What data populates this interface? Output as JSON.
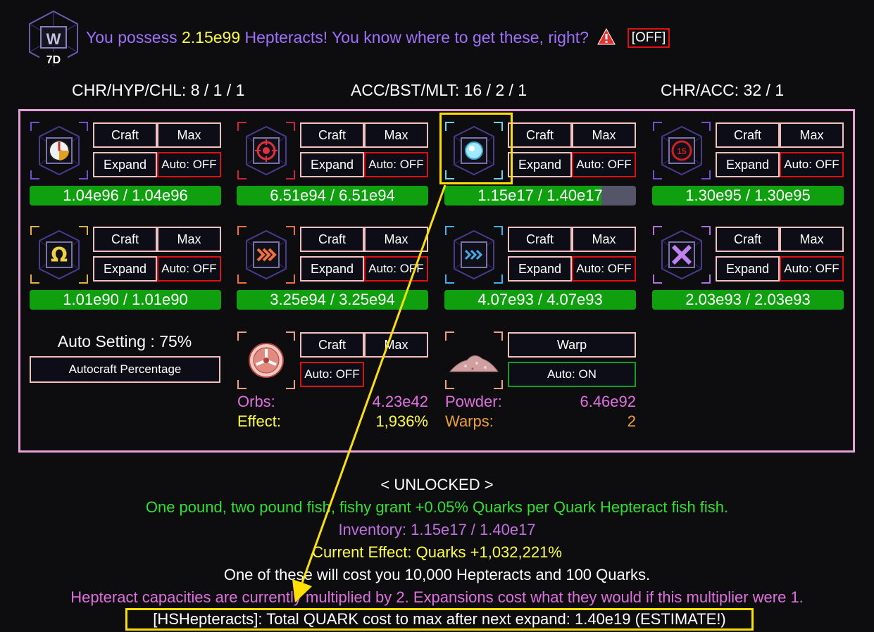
{
  "header": {
    "logo_text": "W",
    "logo_subtext": "7D",
    "prefix": "You possess",
    "amount": "2.15e99",
    "suffix": "Hepteracts! You know where to get these, right?",
    "toggle_label": "[OFF]"
  },
  "ratios": {
    "left": "CHR/HYP/CHL: 8 / 1 / 1",
    "middle": "ACC/BST/MLT: 16 / 2 / 1",
    "right": "CHR/ACC: 32 / 1"
  },
  "buttons": {
    "craft": "Craft",
    "max": "Max",
    "expand": "Expand",
    "auto_off": "Auto: OFF",
    "auto_on": "Auto: ON",
    "warp": "Warp"
  },
  "hepteracts": [
    {
      "name": "chronos",
      "icon": "clock-icon",
      "accent": "#7050d0",
      "bar_text": "1.04e96 / 1.04e96",
      "fill": 1.0
    },
    {
      "name": "hyperrealism",
      "icon": "target-icon",
      "accent": "#d02040",
      "bar_text": "6.51e94 / 6.51e94",
      "fill": 1.0
    },
    {
      "name": "quark",
      "icon": "quark-orb-icon",
      "accent": "#70d0f0",
      "bar_text": "1.15e17 / 1.40e17",
      "fill": 0.82
    },
    {
      "name": "challenge",
      "icon": "challenge-15-icon",
      "accent": "#7050d0",
      "bar_text": "1.30e95 / 1.30e95",
      "fill": 1.0
    },
    {
      "name": "abyss",
      "icon": "omega-icon",
      "accent": "#e0b040",
      "bar_text": "1.01e90 / 1.01e90",
      "fill": 1.0
    },
    {
      "name": "accelerator",
      "icon": "orange-chevrons-icon",
      "accent": "#f07040",
      "bar_text": "3.25e94 / 3.25e94",
      "fill": 1.0
    },
    {
      "name": "accelerator-boost",
      "icon": "blue-chevrons-icon",
      "accent": "#40b0f0",
      "bar_text": "4.07e93 / 4.07e93",
      "fill": 1.0
    },
    {
      "name": "multiplier",
      "icon": "x-icon",
      "accent": "#b070e0",
      "bar_text": "2.03e93 / 2.03e93",
      "fill": 1.0
    }
  ],
  "auto_setting": {
    "label": "Auto Setting : 75%",
    "button": "Autocraft Percentage"
  },
  "orbs": {
    "icon": "orb-icon",
    "orbs_label": "Orbs:",
    "orbs_value": "4.23e42",
    "effect_label": "Effect:",
    "effect_value": "1,936%"
  },
  "powder": {
    "icon": "powder-pile-icon",
    "powder_label": "Powder:",
    "powder_value": "6.46e92",
    "warps_label": "Warps:",
    "warps_value": "2"
  },
  "details": {
    "unlocked": "< UNLOCKED >",
    "description": "One pound, two pound fish, fishy grant +0.05% Quarks per Quark Hepteract fish fish.",
    "inventory": "Inventory: 1.15e17 / 1.40e17",
    "effect": "Current Effect: Quarks +1,032,221%",
    "cost": "One of these will cost you 10,000 Hepteracts and 100 Quarks.",
    "multiplier": "Hepteract capacities are currently multiplied by 2. Expansions cost what they would if this multiplier were 1.",
    "hs_estimate": "[HSHepteracts]: Total QUARK cost to max after next expand: 1.40e19 (ESTIMATE!)"
  },
  "colors": {
    "purple_text": "#a070ff",
    "yellow": "#ffff40",
    "green_text": "#30e030",
    "pink_text": "#e070e0",
    "orange_text": "#f0a030",
    "bar_green": "#0f9f0f",
    "box_border": "#e8a0d8",
    "annotation": "#ffe000"
  }
}
